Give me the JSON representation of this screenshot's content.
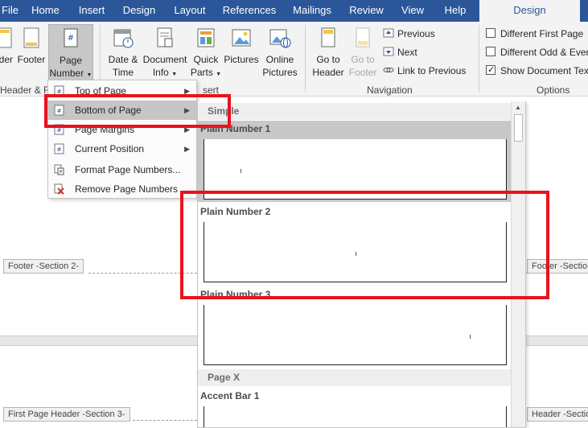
{
  "ribbon_tabs": [
    {
      "label": "File"
    },
    {
      "label": "Home"
    },
    {
      "label": "Insert"
    },
    {
      "label": "Design"
    },
    {
      "label": "Layout"
    },
    {
      "label": "References"
    },
    {
      "label": "Mailings"
    },
    {
      "label": "Review"
    },
    {
      "label": "View"
    },
    {
      "label": "Help"
    },
    {
      "label": "Design",
      "active": true
    }
  ],
  "ribbon": {
    "header_partial": "ader",
    "footer": "Footer",
    "page_number": [
      "Page",
      "Number"
    ],
    "date_time": [
      "Date &",
      "Time"
    ],
    "document_info": [
      "Document",
      "Info"
    ],
    "quick_parts": [
      "Quick",
      "Parts"
    ],
    "pictures": "Pictures",
    "online_pictures": [
      "Online",
      "Pictures"
    ],
    "group_header_footer": "Header & F",
    "group_insert_partial": "sert",
    "go_to_header": [
      "Go to",
      "Header"
    ],
    "go_to_footer": [
      "Go to",
      "Footer"
    ],
    "nav_previous": "Previous",
    "nav_next": "Next",
    "nav_link_previous": "Link to Previous",
    "group_navigation": "Navigation",
    "opt_different_first_page": "Different First Page",
    "opt_different_odd_even": "Different Odd & Even",
    "opt_show_document_text": "Show Document Text",
    "group_options": "Options",
    "opt_show_document_text_checked": true
  },
  "dropdown_menu": {
    "items": [
      {
        "label": "Top of Page",
        "has_submenu": true,
        "icon": "page-number-icon"
      },
      {
        "label": "Bottom of Page",
        "has_submenu": true,
        "icon": "page-number-icon",
        "highlighted": true
      },
      {
        "label": "Page Margins",
        "has_submenu": true,
        "icon": "page-number-icon"
      },
      {
        "label": "Current Position",
        "has_submenu": true,
        "icon": "page-number-icon"
      },
      {
        "label": "Format Page Numbers...",
        "has_submenu": false,
        "icon": "format-icon"
      },
      {
        "label": "Remove Page Numbers",
        "has_submenu": false,
        "icon": "remove-icon"
      }
    ]
  },
  "gallery": {
    "section_simple": "Simple",
    "item1": "Plain Number 1",
    "item2": "Plain Number 2",
    "item3": "Plain Number 3",
    "section_page_x": "Page X",
    "item4": "Accent Bar 1"
  },
  "document": {
    "footer_left": "Footer -Section 2-",
    "footer_right": "Footer -Sectio",
    "first_page_header_left": "First Page Header -Section 3-",
    "header_right": "Header -Sectio"
  },
  "colors": {
    "tab_bar": "#2b579a",
    "ribbon_bg": "#f3f3f3",
    "highlight_red": "#e8121d",
    "menu_highlight": "#c6c6c6"
  }
}
